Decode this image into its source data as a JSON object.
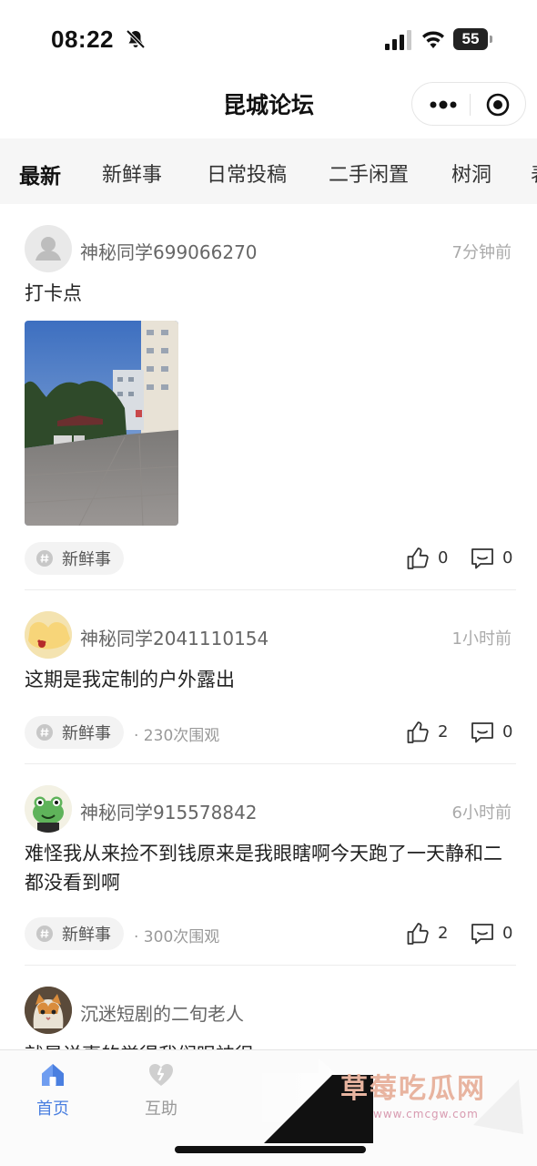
{
  "status_bar": {
    "time": "08:22",
    "battery": "55"
  },
  "nav": {
    "title": "昆城论坛"
  },
  "tabs": [
    {
      "label": "最新"
    },
    {
      "label": "新鲜事"
    },
    {
      "label": "日常投稿"
    },
    {
      "label": "二手闲置"
    },
    {
      "label": "树洞"
    },
    {
      "label": "表"
    }
  ],
  "posts": [
    {
      "author": "神秘同学699066270",
      "time": "7分钟前",
      "content": "打卡点",
      "tag": "新鲜事",
      "views": "",
      "likes": "0",
      "comments": "0"
    },
    {
      "author": "神秘同学2041110154",
      "time": "1小时前",
      "content": "这期是我定制的户外露出",
      "tag": "新鲜事",
      "views": "· 230次围观",
      "likes": "2",
      "comments": "0"
    },
    {
      "author": "神秘同学915578842",
      "time": "6小时前",
      "content": "难怪我从来捡不到钱原来是我眼瞎啊今天跑了一天静和二都没看到啊",
      "tag": "新鲜事",
      "views": "· 300次围观",
      "likes": "2",
      "comments": "0"
    },
    {
      "author": "沉迷短剧的二旬老人",
      "content": "就是说事的觉得我们眼神很"
    }
  ],
  "tabbar": [
    {
      "label": "首页",
      "icon": "home-icon",
      "active": true
    },
    {
      "label": "互助",
      "icon": "help-heart-icon",
      "active": false
    }
  ],
  "watermark": {
    "title": "草莓吃瓜网",
    "url": "www.cmcgw.com"
  },
  "colors": {
    "accent": "#4a7fe0",
    "tabs_bg": "#f6f6f6",
    "tag_bg": "#f3f3f3"
  }
}
